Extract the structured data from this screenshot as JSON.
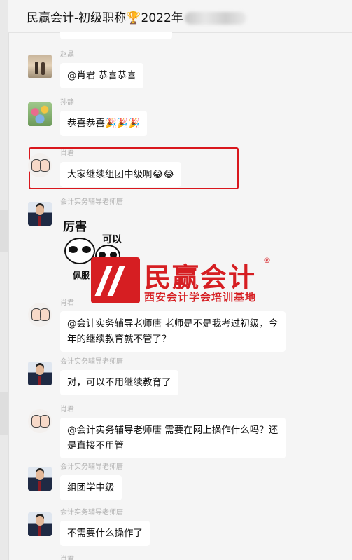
{
  "header": {
    "title": "民赢会计-初级职称",
    "trophy": "🏆",
    "suffix": "2022年"
  },
  "messages": [
    {
      "sender": "赵晶",
      "text": "@肖君 恭喜恭喜",
      "avatar": "sunset-couple"
    },
    {
      "sender": "孙静",
      "text": "恭喜恭喜🎉🎉🎉",
      "avatar": "flowers"
    },
    {
      "sender": "肖君",
      "text": "大家继续组团中级啊😂😂",
      "avatar": "cartoon-couple",
      "highlighted": true
    },
    {
      "sender": "会计实务辅导老师唐",
      "sticker": {
        "line1": "厉害",
        "line2": "可以",
        "line3": "佩服"
      },
      "avatar": "teacher"
    },
    {
      "sender": "肖君",
      "text": "@会计实务辅导老师唐 老师是不是我考过初级，今年的继续教育就不管了？",
      "avatar": "cartoon-couple"
    },
    {
      "sender": "会计实务辅导老师唐",
      "text": "对，可以不用继续教育了",
      "avatar": "teacher"
    },
    {
      "sender": "肖君",
      "text": "@会计实务辅导老师唐 需要在网上操作什么吗？还是直接不用管",
      "avatar": "cartoon-couple"
    },
    {
      "sender": "会计实务辅导老师唐",
      "text": "组团学中级",
      "avatar": "teacher"
    },
    {
      "sender": "会计实务辅导老师唐",
      "text": "不需要什么操作了",
      "avatar": "teacher"
    },
    {
      "sender": "肖君",
      "avatar": "cartoon-couple"
    }
  ],
  "watermark": {
    "name": "民赢会计",
    "registered": "®",
    "subtitle": "西安会计学会培训基地"
  },
  "colors": {
    "highlight": "#d9171d",
    "watermark": "#d61e22",
    "bubble": "#ffffff",
    "background": "#f5f5f5"
  }
}
